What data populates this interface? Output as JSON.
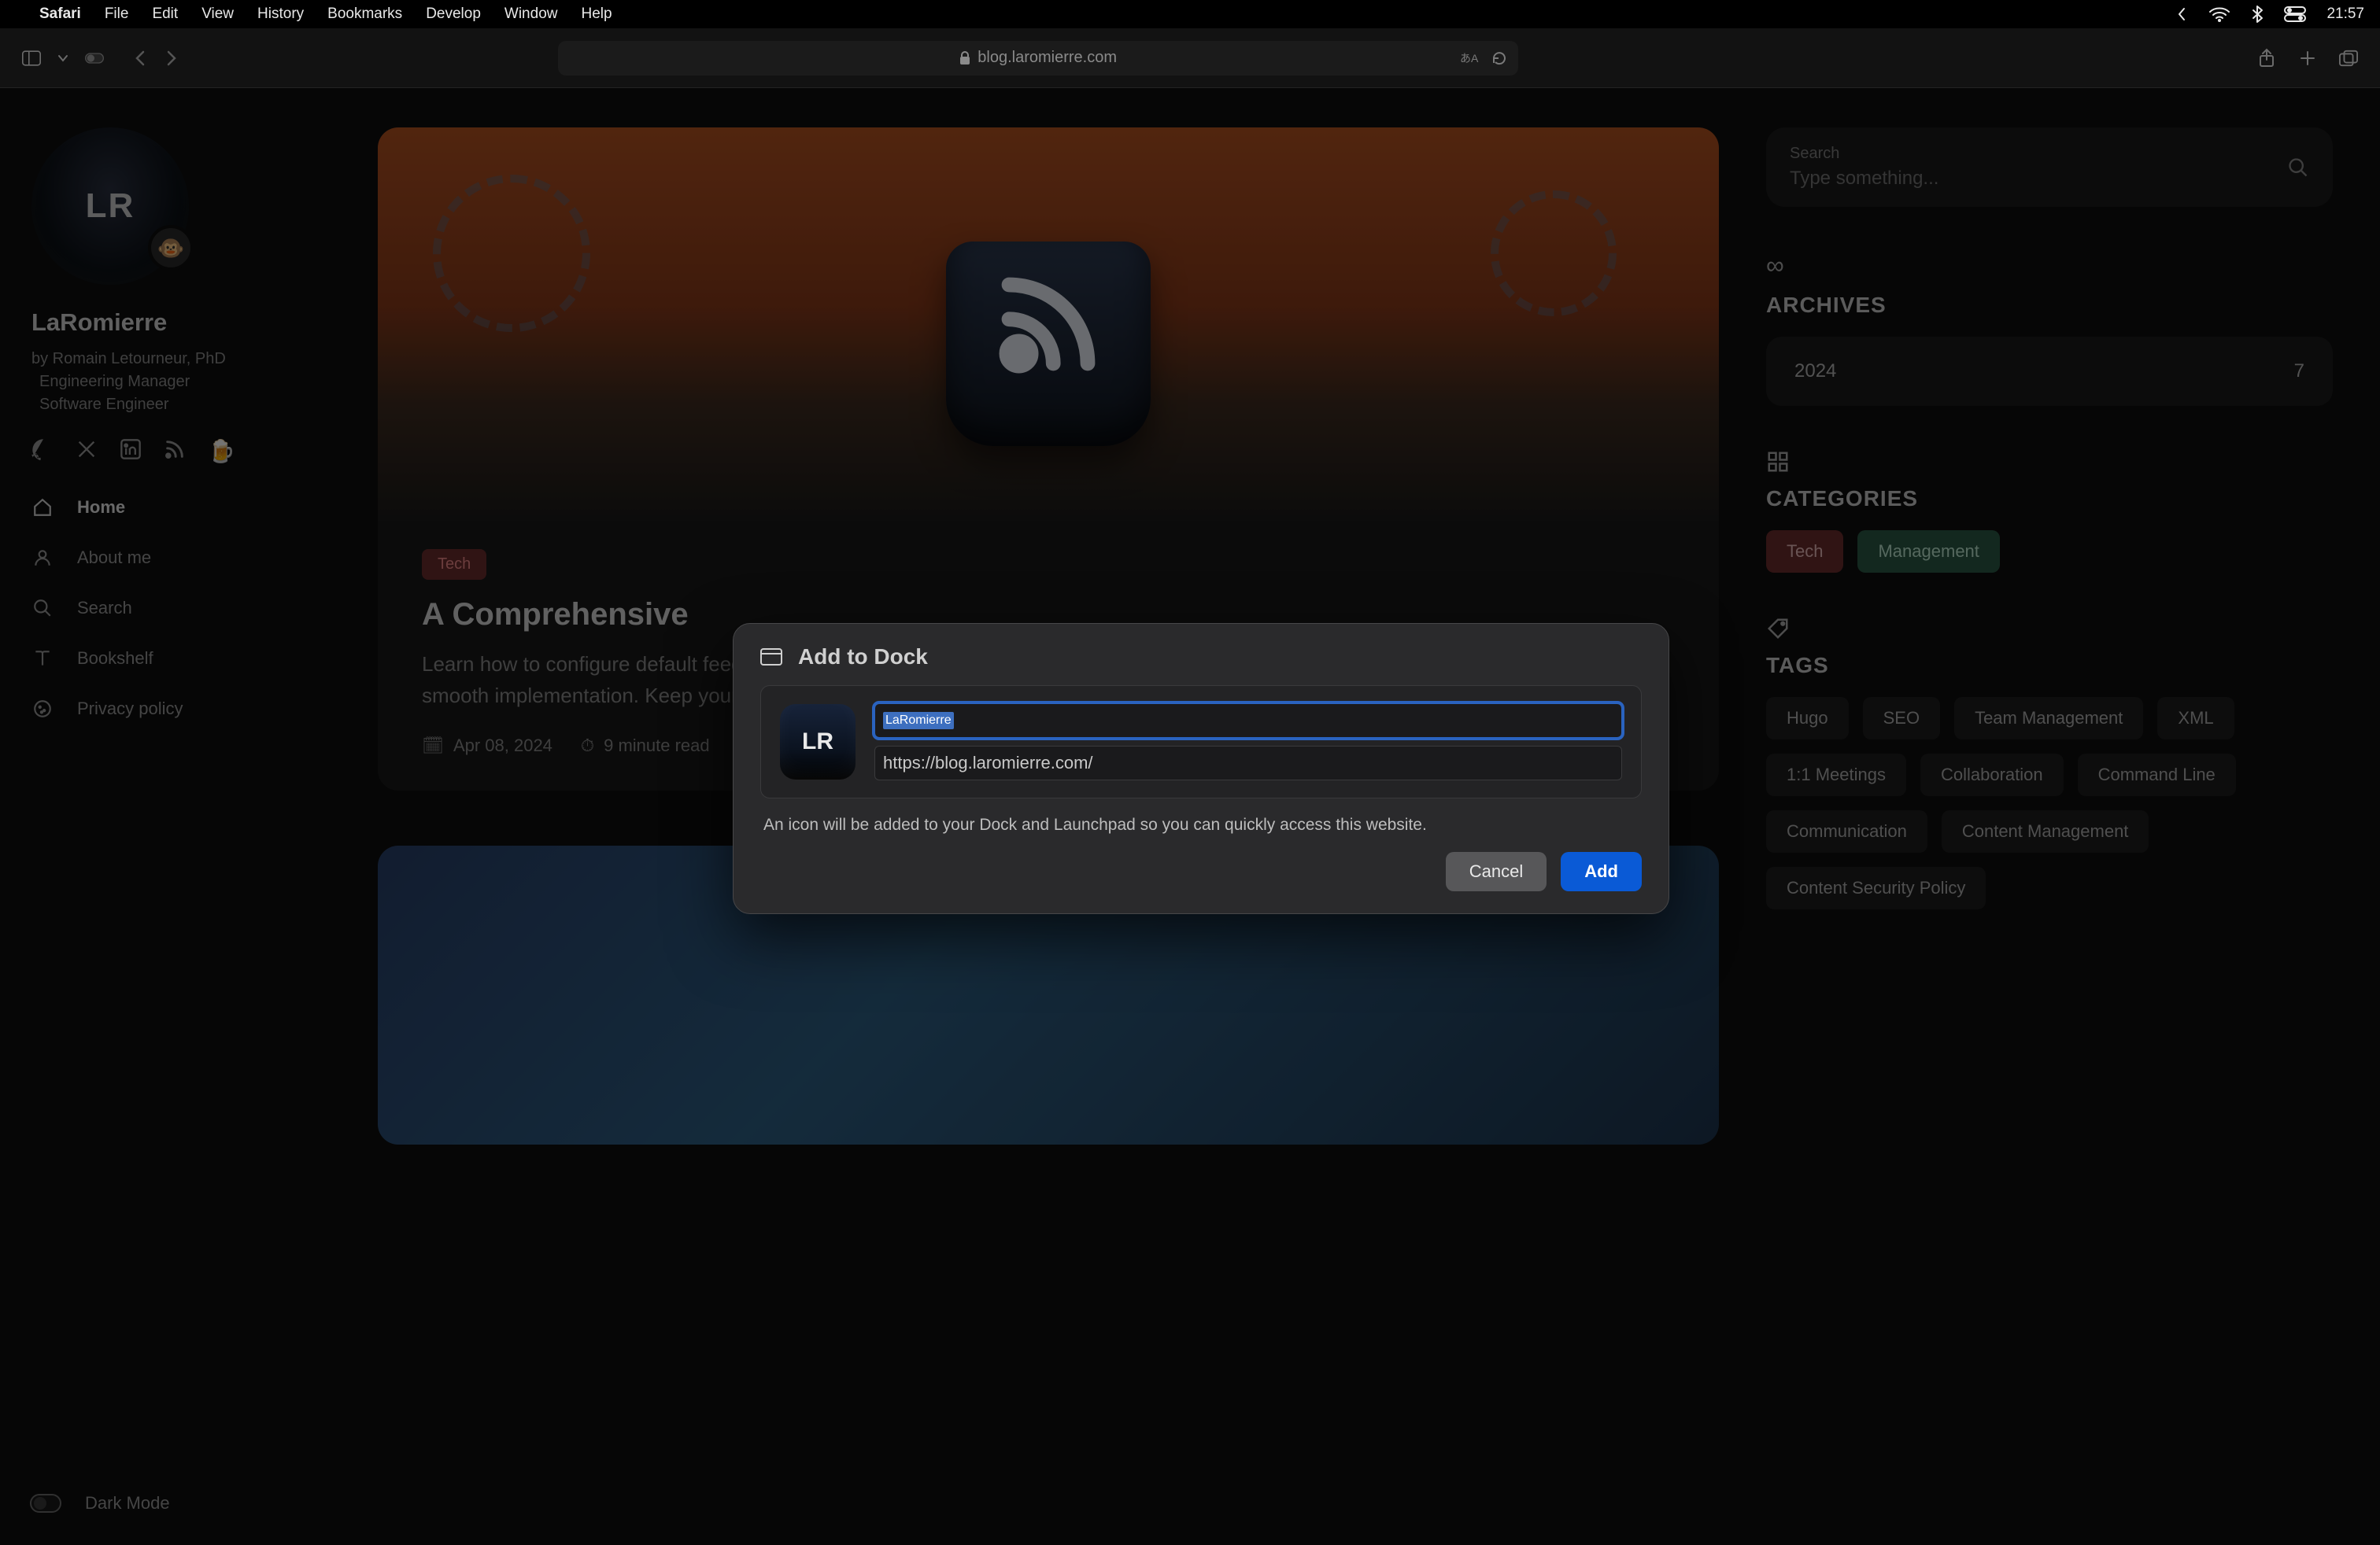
{
  "menubar": {
    "app": "Safari",
    "items": [
      "File",
      "Edit",
      "View",
      "History",
      "Bookmarks",
      "Develop",
      "Window",
      "Help"
    ],
    "clock": "21:57"
  },
  "toolbar": {
    "url_display": "blog.laromierre.com"
  },
  "sidebar": {
    "logo_text": "LR",
    "title": "LaRomierre",
    "byline1": "by Romain Letourneur, PhD",
    "byline2": "Engineering Manager",
    "byline3": "Software Engineer",
    "nav": [
      {
        "label": "Home",
        "active": true
      },
      {
        "label": "About me",
        "active": false
      },
      {
        "label": "Search",
        "active": false
      },
      {
        "label": "Bookshelf",
        "active": false
      },
      {
        "label": "Privacy policy",
        "active": false
      }
    ],
    "dark_mode_label": "Dark Mode"
  },
  "main": {
    "post1": {
      "tag": "Tech",
      "title": "A Comprehensive",
      "desc": "Learn how to configure default feeds to contro to give you a good cov managing displayed el leveraging customization options for a smooth implementation. Keep your audience engaged and informed with ease.",
      "date": "Apr 08, 2024",
      "read": "9 minute read"
    }
  },
  "right": {
    "search_label": "Search",
    "search_placeholder": "Type something...",
    "archives_label": "ARCHIVES",
    "archive_year": "2024",
    "archive_count": "7",
    "categories_label": "CATEGORIES",
    "cat_tech": "Tech",
    "cat_mgmt": "Management",
    "tags_label": "TAGS",
    "tags": [
      "Hugo",
      "SEO",
      "Team Management",
      "XML",
      "1:1 Meetings",
      "Collaboration",
      "Command Line",
      "Communication",
      "Content Management",
      "Content Security Policy"
    ]
  },
  "modal": {
    "title": "Add to Dock",
    "name_value": "LaRomierre",
    "url_value": "https://blog.laromierre.com/",
    "hint": "An icon will be added to your Dock and Launchpad so you can quickly access this website.",
    "cancel": "Cancel",
    "add": "Add",
    "icon_text": "LR"
  }
}
